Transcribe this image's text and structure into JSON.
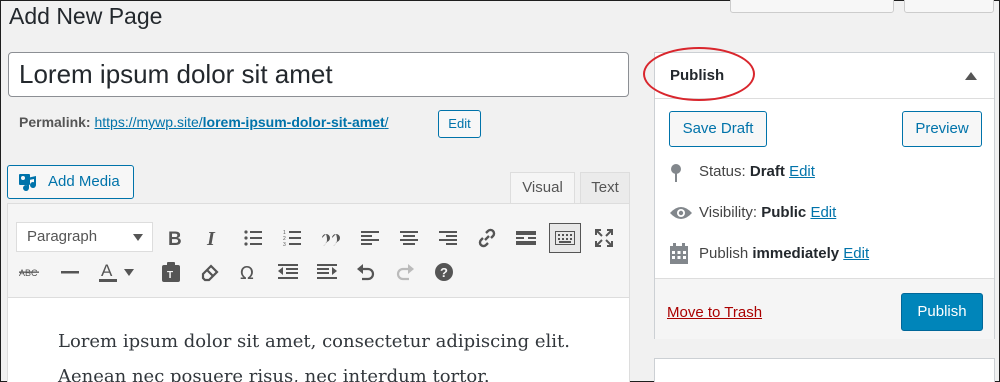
{
  "page": {
    "title": "Add New Page"
  },
  "post": {
    "title_value": "Lorem ipsum dolor sit amet",
    "permalink_label": "Permalink:",
    "permalink_base": "https://mywp.site/",
    "permalink_slug": "lorem-ipsum-dolor-sit-amet",
    "permalink_trailing": "/",
    "edit_label": "Edit"
  },
  "editor": {
    "add_media_label": "Add Media",
    "tabs": [
      {
        "label": "Visual",
        "active": true
      },
      {
        "label": "Text",
        "active": false
      }
    ],
    "format_select_value": "Paragraph",
    "toolbar_row1_icons": [
      "bold-icon",
      "italic-icon",
      "bulleted-list-icon",
      "numbered-list-icon",
      "blockquote-icon",
      "align-left-icon",
      "align-center-icon",
      "align-right-icon",
      "insert-link-icon",
      "read-more-icon",
      "toolbar-toggle-icon",
      "distraction-free-icon"
    ],
    "toolbar_row2_icons": [
      "strikethrough-icon",
      "horizontal-line-icon",
      "text-color-icon",
      "paste-as-text-icon",
      "clear-formatting-icon",
      "special-character-icon",
      "decrease-indent-icon",
      "increase-indent-icon",
      "undo-icon",
      "redo-icon",
      "keyboard-shortcuts-icon"
    ],
    "content": "Lorem ipsum dolor sit amet, consectetur adipiscing elit. Aenean nec posuere risus, nec interdum tortor."
  },
  "publish_box": {
    "title": "Publish",
    "save_draft_label": "Save Draft",
    "preview_label": "Preview",
    "status_label": "Status:",
    "status_value": "Draft",
    "visibility_label": "Visibility:",
    "visibility_value": "Public",
    "publish_label": "Publish",
    "publish_value": "immediately",
    "edit_label": "Edit",
    "trash_label": "Move to Trash",
    "publish_button_label": "Publish"
  },
  "colors": {
    "link": "#0073aa",
    "primary_button": "#0085ba",
    "trash": "#a00",
    "highlight_circle": "#d9262d"
  }
}
